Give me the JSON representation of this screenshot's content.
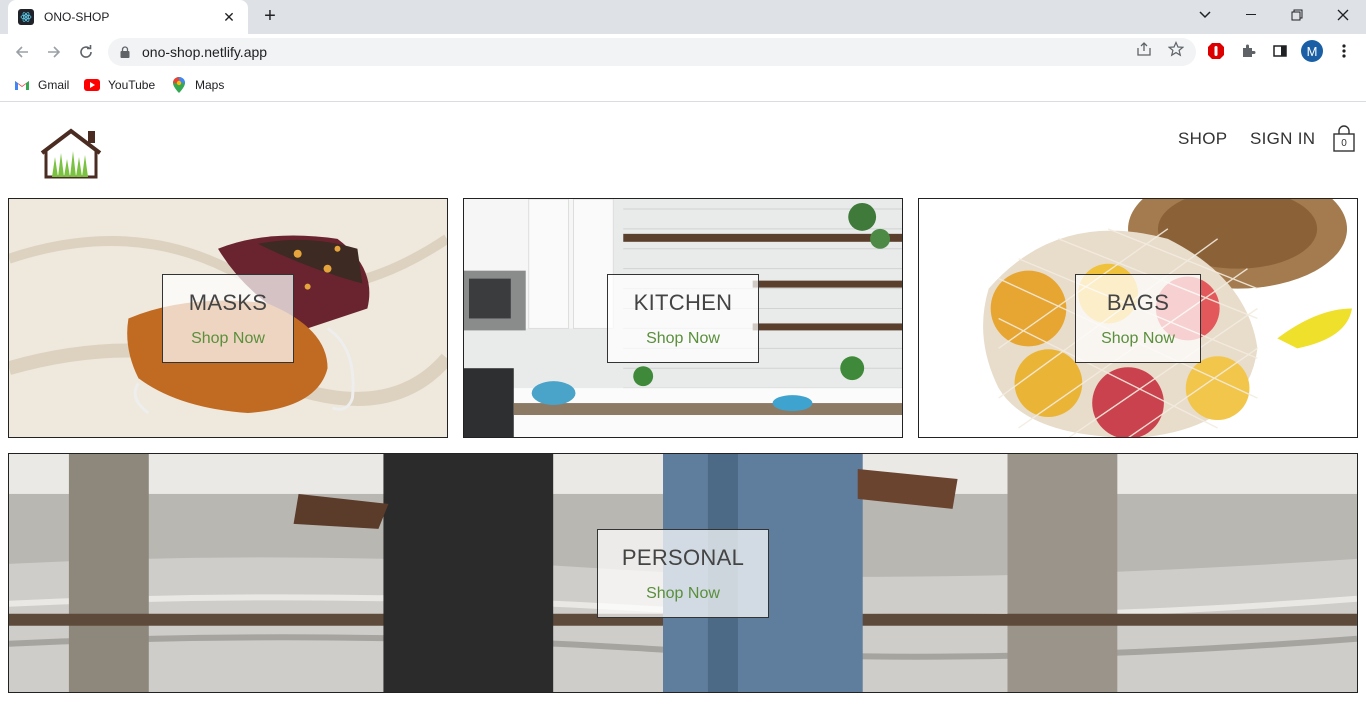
{
  "browser": {
    "tab_title": "ONO-SHOP",
    "url": "ono-shop.netlify.app",
    "profile_initial": "M",
    "bookmarks": [
      {
        "label": "Gmail",
        "icon": "gmail-icon"
      },
      {
        "label": "YouTube",
        "icon": "youtube-icon"
      },
      {
        "label": "Maps",
        "icon": "maps-icon"
      }
    ]
  },
  "header": {
    "nav": {
      "shop": "SHOP",
      "sign_in": "SIGN IN"
    },
    "cart_count": "0"
  },
  "categories": [
    {
      "title": "MASKS",
      "cta": "Shop Now"
    },
    {
      "title": "KITCHEN",
      "cta": "Shop Now"
    },
    {
      "title": "BAGS",
      "cta": "Shop Now"
    },
    {
      "title": "PERSONAL",
      "cta": "Shop Now"
    }
  ],
  "colors": {
    "accent_green": "#5a8f3c",
    "logo_brown": "#4a2c22",
    "logo_grass": "#7cc242"
  }
}
